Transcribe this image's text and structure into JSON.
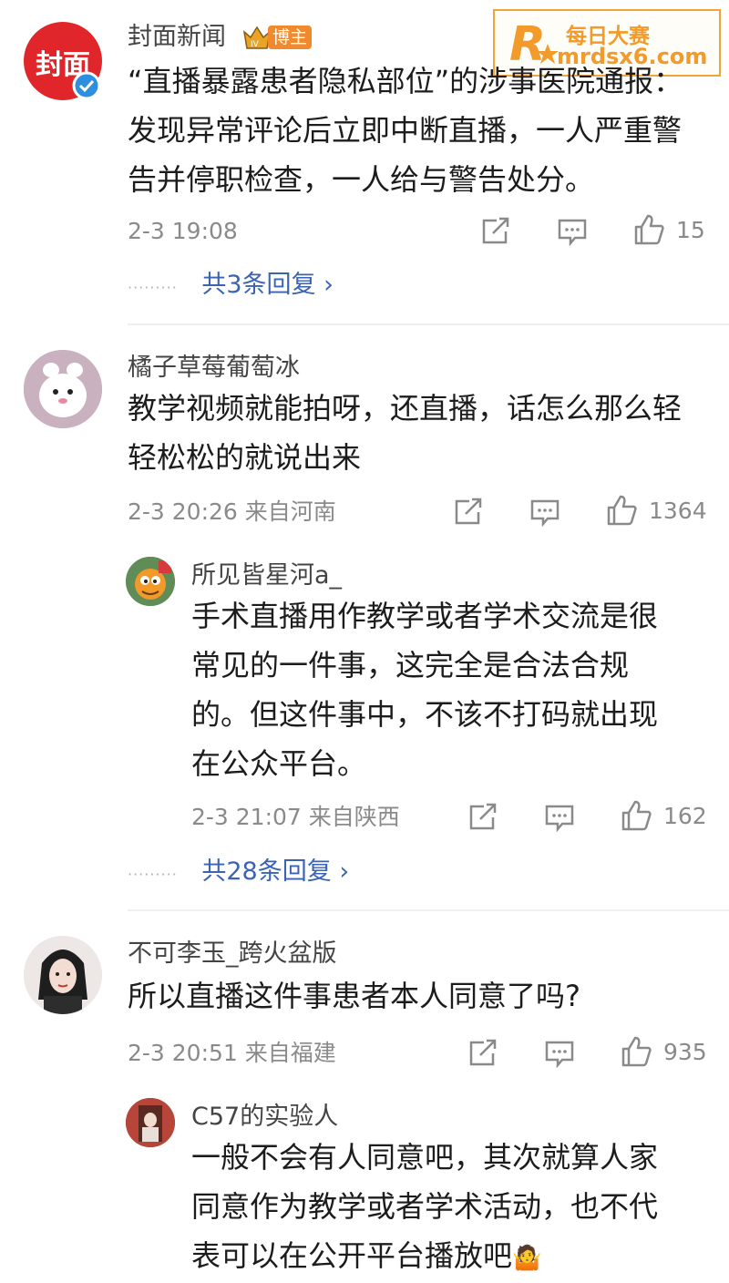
{
  "watermark": {
    "logo_letter": "R",
    "brand_cn": "每日大赛",
    "domain": "mrdsx6.com"
  },
  "post": {
    "author": "封面新闻",
    "avatar_text": "封面",
    "badge_level": "IV",
    "badge_label": "博主",
    "lines": [
      "“直播暴露患者隐私部位”的涉事医院通报：",
      "发现异常评论后立即中断直播，一人严重警",
      "告并停职检查，一人给与警告处分。"
    ],
    "time": "2-3 19:08",
    "likes": "15",
    "replies_label": "共3条回复 ›"
  },
  "comments": [
    {
      "author": "橘子草莓葡萄冰",
      "lines": [
        "教学视频就能拍呀，还直播，话怎么那么轻",
        "轻松松的就说出来"
      ],
      "time": "2-3 20:26 来自河南",
      "likes": "1364",
      "reply": {
        "author": "所见皆星河a_",
        "lines": [
          "手术直播用作教学或者学术交流是很",
          "常见的一件事，这完全是合法合规",
          "的。但这件事中，不该不打码就出现",
          "在公众平台。"
        ],
        "time": "2-3 21:07 来自陕西",
        "likes": "162"
      },
      "replies_label": "共28条回复 ›"
    },
    {
      "author": "不可李玉_跨火盆版",
      "lines": [
        "所以直播这件事患者本人同意了吗?"
      ],
      "time": "2-3 20:51 来自福建",
      "likes": "935",
      "reply": {
        "author": "C57的实验人",
        "lines": [
          "一般不会有人同意吧，其次就算人家",
          "同意作为教学或者学术活动，也不代",
          "表可以在公开平台播放吧"
        ],
        "emoji": "🤷"
      }
    }
  ],
  "colors": {
    "link_blue": "#3a63b4",
    "brand_orange": "#ee7a22",
    "logo_red": "#e0262a",
    "meta_gray": "#8a8a8a"
  },
  "icons": [
    "share-icon",
    "comment-icon",
    "like-icon",
    "verified-icon",
    "crown-icon"
  ]
}
